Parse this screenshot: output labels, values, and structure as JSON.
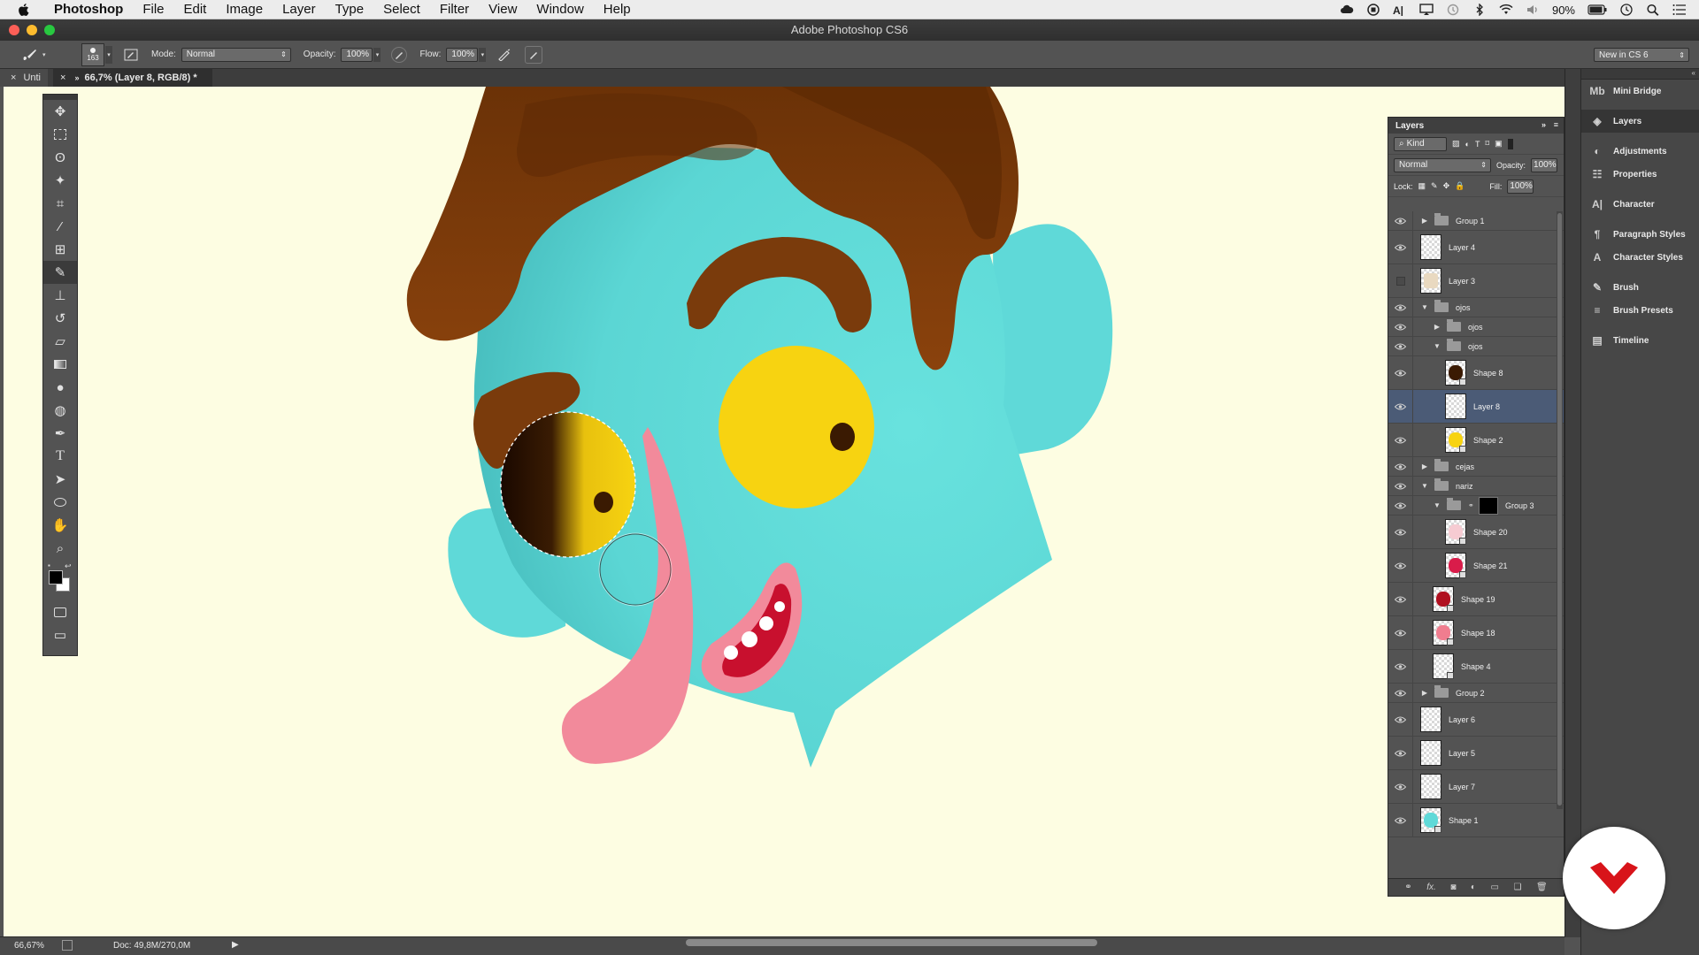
{
  "menubar": {
    "app_name": "Photoshop",
    "items": [
      "File",
      "Edit",
      "Image",
      "Layer",
      "Type",
      "Select",
      "Filter",
      "View",
      "Window",
      "Help"
    ],
    "battery": "90%"
  },
  "window": {
    "title": "Adobe Photoshop CS6"
  },
  "options": {
    "brush_size": "163",
    "mode_label": "Mode:",
    "mode_value": "Normal",
    "opacity_label": "Opacity:",
    "opacity_value": "100%",
    "flow_label": "Flow:",
    "flow_value": "100%",
    "workspace": "New in CS 6"
  },
  "doc_tabs": {
    "tab1": "Unti",
    "tab2": "66,7% (Layer 8, RGB/8) *"
  },
  "status": {
    "zoom": "66,67%",
    "doc": "Doc: 49,8M/270,0M"
  },
  "layers_panel": {
    "title": "Layers",
    "filter_kind": "Kind",
    "blend_mode": "Normal",
    "opacity_label": "Opacity:",
    "opacity_value": "100%",
    "lock_label": "Lock:",
    "fill_label": "Fill:",
    "fill_value": "100%",
    "layers": [
      {
        "name": "Group 1",
        "type": "group",
        "indent": 0,
        "expanded": false,
        "visible": true
      },
      {
        "name": "Layer 4",
        "type": "layer",
        "indent": 0,
        "visible": true
      },
      {
        "name": "Layer 3",
        "type": "layer",
        "indent": 0,
        "visible": false
      },
      {
        "name": "ojos",
        "type": "group",
        "indent": 0,
        "expanded": true,
        "visible": true
      },
      {
        "name": "ojos",
        "type": "group",
        "indent": 1,
        "expanded": false,
        "visible": true
      },
      {
        "name": "ojos",
        "type": "group",
        "indent": 1,
        "expanded": true,
        "visible": true
      },
      {
        "name": "Shape 8",
        "type": "shape",
        "indent": 2,
        "visible": true
      },
      {
        "name": "Layer 8",
        "type": "layer",
        "indent": 2,
        "visible": true,
        "selected": true
      },
      {
        "name": "Shape 2",
        "type": "shape",
        "indent": 2,
        "visible": true
      },
      {
        "name": "cejas",
        "type": "group",
        "indent": 0,
        "expanded": false,
        "visible": true
      },
      {
        "name": "nariz",
        "type": "group",
        "indent": 0,
        "expanded": true,
        "visible": true
      },
      {
        "name": "Group 3",
        "type": "group",
        "indent": 1,
        "expanded": true,
        "visible": true
      },
      {
        "name": "Shape 20",
        "type": "shape",
        "indent": 2,
        "visible": true
      },
      {
        "name": "Shape 21",
        "type": "shape",
        "indent": 2,
        "visible": true
      },
      {
        "name": "Shape 19",
        "type": "shape",
        "indent": 1,
        "visible": true
      },
      {
        "name": "Shape 18",
        "type": "shape",
        "indent": 1,
        "visible": true
      },
      {
        "name": "Shape 4",
        "type": "shape",
        "indent": 1,
        "visible": true
      },
      {
        "name": "Group 2",
        "type": "group",
        "indent": 0,
        "expanded": false,
        "visible": true
      },
      {
        "name": "Layer 6",
        "type": "layer",
        "indent": 0,
        "visible": true
      },
      {
        "name": "Layer 5",
        "type": "layer",
        "indent": 0,
        "visible": true
      },
      {
        "name": "Layer 7",
        "type": "layer",
        "indent": 0,
        "visible": true
      },
      {
        "name": "Shape 1",
        "type": "shape",
        "indent": 0,
        "visible": true
      }
    ]
  },
  "dock": {
    "items": [
      {
        "label": "Mini Bridge",
        "icon": "mini-bridge-icon",
        "glyph": "Mb"
      },
      {
        "label": "Layers",
        "icon": "layers-icon",
        "glyph": "◈",
        "active": true
      },
      {
        "label": "Adjustments",
        "icon": "adjustments-icon",
        "glyph": "◐"
      },
      {
        "label": "Properties",
        "icon": "properties-icon",
        "glyph": "☷"
      },
      {
        "label": "Character",
        "icon": "character-icon",
        "glyph": "A|"
      },
      {
        "label": "Paragraph Styles",
        "icon": "paragraph-styles-icon",
        "glyph": "¶"
      },
      {
        "label": "Character Styles",
        "icon": "character-styles-icon",
        "glyph": "A"
      },
      {
        "label": "Brush",
        "icon": "brush-icon",
        "glyph": "✎"
      },
      {
        "label": "Brush Presets",
        "icon": "brush-presets-icon",
        "glyph": "≡"
      },
      {
        "label": "Timeline",
        "icon": "timeline-icon",
        "glyph": "▤"
      }
    ]
  },
  "colors": {
    "canvas_bg": "#fdfde2",
    "face": "#62dbd9",
    "hair": "#7a3b0c",
    "eye": "#f7d311",
    "tongue": "#f28a9b",
    "brand": "#d8141a"
  }
}
